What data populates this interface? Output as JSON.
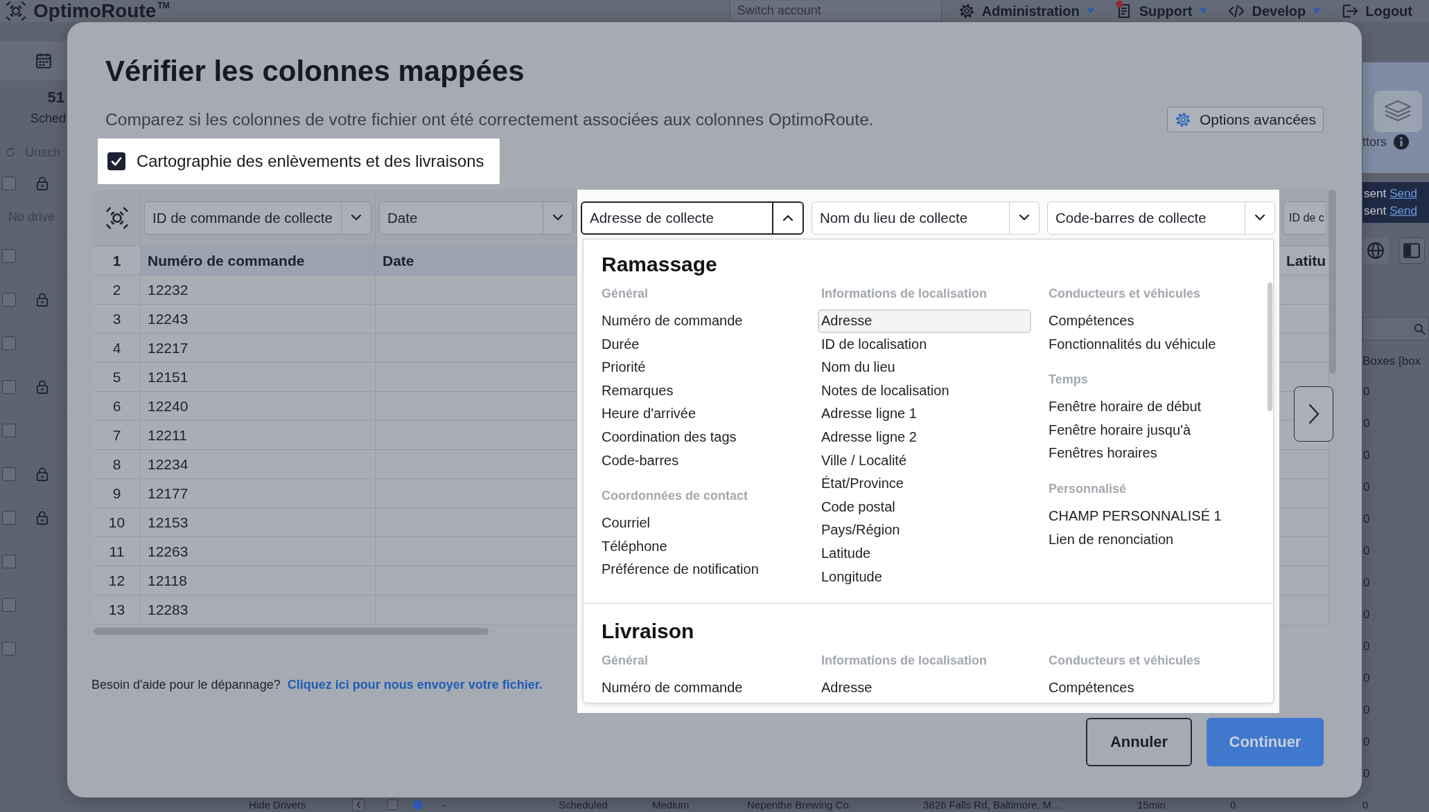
{
  "app_header": {
    "logo": "OptimoRoute",
    "trademark": "TM",
    "account_search": {
      "placeholder": "Switch account"
    },
    "menus": [
      {
        "label": "Administration",
        "kind": "settings",
        "notification": false
      },
      {
        "label": "Support",
        "kind": "support",
        "notification": true
      },
      {
        "label": "Develop",
        "kind": "code",
        "notification": false
      }
    ],
    "logout": "Logout"
  },
  "left_panel": {
    "stat_value": "51",
    "stat_label": "Sched",
    "unscheduled": "Unsch",
    "header_row": {
      "checked": false,
      "locked": true
    },
    "no_driver": "No drive",
    "rows": [
      {
        "checked": false,
        "locked": false
      },
      {
        "checked": false,
        "locked": true
      },
      {
        "checked": false,
        "locked": false
      },
      {
        "checked": false,
        "locked": true
      },
      {
        "checked": false,
        "locked": false
      },
      {
        "checked": false,
        "locked": true
      },
      {
        "checked": false,
        "locked": true
      },
      {
        "checked": false,
        "locked": false
      },
      {
        "checked": false,
        "locked": false
      },
      {
        "checked": false,
        "locked": false
      }
    ]
  },
  "modal": {
    "title": "Vérifier les colonnes mappées",
    "subtitle": "Comparez si les colonnes de votre fichier ont été correctement associées aux colonnes OptimoRoute.",
    "advanced_button": "Options avancées",
    "pickup_delivery_mapping": {
      "label": "Cartographie des enlèvements et des livraisons",
      "checked": true
    },
    "mapping_table": {
      "column_mappings": [
        {
          "value": "ID de commande de collecte",
          "expanded": false,
          "highlighted": false
        },
        {
          "value": "Date",
          "expanded": false,
          "highlighted": false
        },
        {
          "value": "Adresse de collecte",
          "expanded": true,
          "highlighted": true
        },
        {
          "value": "Nom du lieu de collecte",
          "expanded": false,
          "highlighted": true
        },
        {
          "value": "Code-barres de collecte",
          "expanded": false,
          "highlighted": true
        },
        {
          "value": "ID de c",
          "highlighted": false
        }
      ],
      "header_row": {
        "number": "1",
        "column_1": "Numéro de commande",
        "column_2": "Date",
        "column_6": "Latitu"
      },
      "rows": [
        {
          "number": "2",
          "order": "12232"
        },
        {
          "number": "3",
          "order": "12243"
        },
        {
          "number": "4",
          "order": "12217"
        },
        {
          "number": "5",
          "order": "12151"
        },
        {
          "number": "6",
          "order": "12240"
        },
        {
          "number": "7",
          "order": "12211"
        },
        {
          "number": "8",
          "order": "12234"
        },
        {
          "number": "9",
          "order": "12177"
        },
        {
          "number": "10",
          "order": "12153"
        },
        {
          "number": "11",
          "order": "12263"
        },
        {
          "number": "12",
          "order": "12118"
        },
        {
          "number": "13",
          "order": "12283"
        }
      ]
    },
    "dropdown_menu": {
      "sections": [
        {
          "title": "Ramassage",
          "columns": [
            {
              "groups": [
                {
                  "heading": "Général",
                  "items": [
                    {
                      "label": "Numéro de commande",
                      "selected": false
                    },
                    {
                      "label": "Durée",
                      "selected": false
                    },
                    {
                      "label": "Priorité",
                      "selected": false
                    },
                    {
                      "label": "Remarques",
                      "selected": false
                    },
                    {
                      "label": "Heure d'arrivée",
                      "selected": false
                    },
                    {
                      "label": "Coordination des tags",
                      "selected": false
                    },
                    {
                      "label": "Code-barres",
                      "selected": false
                    }
                  ]
                },
                {
                  "heading": "Coordonnées de contact",
                  "items": [
                    {
                      "label": "Courriel",
                      "selected": false
                    },
                    {
                      "label": "Téléphone",
                      "selected": false
                    },
                    {
                      "label": "Préférence de notification",
                      "selected": false
                    }
                  ]
                }
              ]
            },
            {
              "groups": [
                {
                  "heading": "Informations de localisation",
                  "items": [
                    {
                      "label": "Adresse",
                      "selected": true
                    },
                    {
                      "label": "ID de localisation",
                      "selected": false
                    },
                    {
                      "label": "Nom du lieu",
                      "selected": false
                    },
                    {
                      "label": "Notes de localisation",
                      "selected": false
                    },
                    {
                      "label": "Adresse ligne 1",
                      "selected": false
                    },
                    {
                      "label": "Adresse ligne 2",
                      "selected": false
                    },
                    {
                      "label": "Ville / Localité",
                      "selected": false
                    },
                    {
                      "label": "État/Province",
                      "selected": false
                    },
                    {
                      "label": "Code postal",
                      "selected": false
                    },
                    {
                      "label": "Pays/Région",
                      "selected": false
                    },
                    {
                      "label": "Latitude",
                      "selected": false
                    },
                    {
                      "label": "Longitude",
                      "selected": false
                    }
                  ]
                }
              ]
            },
            {
              "groups": [
                {
                  "heading": "Conducteurs et véhicules",
                  "items": [
                    {
                      "label": "Compétences",
                      "selected": false
                    },
                    {
                      "label": "Fonctionnalités du véhicule",
                      "selected": false
                    }
                  ]
                },
                {
                  "heading": "Temps",
                  "items": [
                    {
                      "label": "Fenêtre horaire de début",
                      "selected": false
                    },
                    {
                      "label": "Fenêtre horaire jusqu'à",
                      "selected": false
                    },
                    {
                      "label": "Fenêtres horaires",
                      "selected": false
                    }
                  ]
                },
                {
                  "heading": "Personnalisé",
                  "items": [
                    {
                      "label": "CHAMP PERSONNALISÉ 1",
                      "selected": false
                    },
                    {
                      "label": "Lien de renonciation",
                      "selected": false
                    }
                  ]
                }
              ]
            }
          ]
        },
        {
          "title": "Livraison",
          "columns": [
            {
              "groups": [
                {
                  "heading": "Général",
                  "items": [
                    {
                      "label": "Numéro de commande",
                      "selected": false
                    }
                  ]
                }
              ]
            },
            {
              "groups": [
                {
                  "heading": "Informations de localisation",
                  "items": [
                    {
                      "label": "Adresse",
                      "selected": false
                    }
                  ]
                }
              ]
            },
            {
              "groups": [
                {
                  "heading": "Conducteurs et véhicules",
                  "items": [
                    {
                      "label": "Compétences",
                      "selected": false
                    }
                  ]
                }
              ]
            }
          ]
        }
      ]
    },
    "help": {
      "text": "Besoin d'aide pour le dépannage?",
      "link": "Cliquez ici pour nous envoyer votre fichier."
    },
    "buttons": [
      {
        "label": "Annuler",
        "kind": "secondary"
      },
      {
        "label": "Continuer",
        "kind": "primary"
      }
    ]
  },
  "right_panel": {
    "label": "ttors",
    "notices": [
      {
        "text": "sent",
        "link": "Send"
      },
      {
        "text": "sent",
        "link": "Send"
      }
    ],
    "column_label": "Boxes [box",
    "values": [
      "0",
      "0",
      "0",
      "0",
      "0",
      "0",
      "0",
      "0",
      "0",
      "0",
      "0",
      "0",
      "0"
    ]
  },
  "bottom_row": {
    "label": "Hide Drivers",
    "checked": false,
    "dash": "-",
    "status": "Scheduled",
    "priority": "Medium",
    "location": "Nepenthe Brewing Co.",
    "address": "3826 Falls Rd, Baltimore, M…",
    "duration": "15min",
    "count": "0",
    "boxes": "0"
  }
}
